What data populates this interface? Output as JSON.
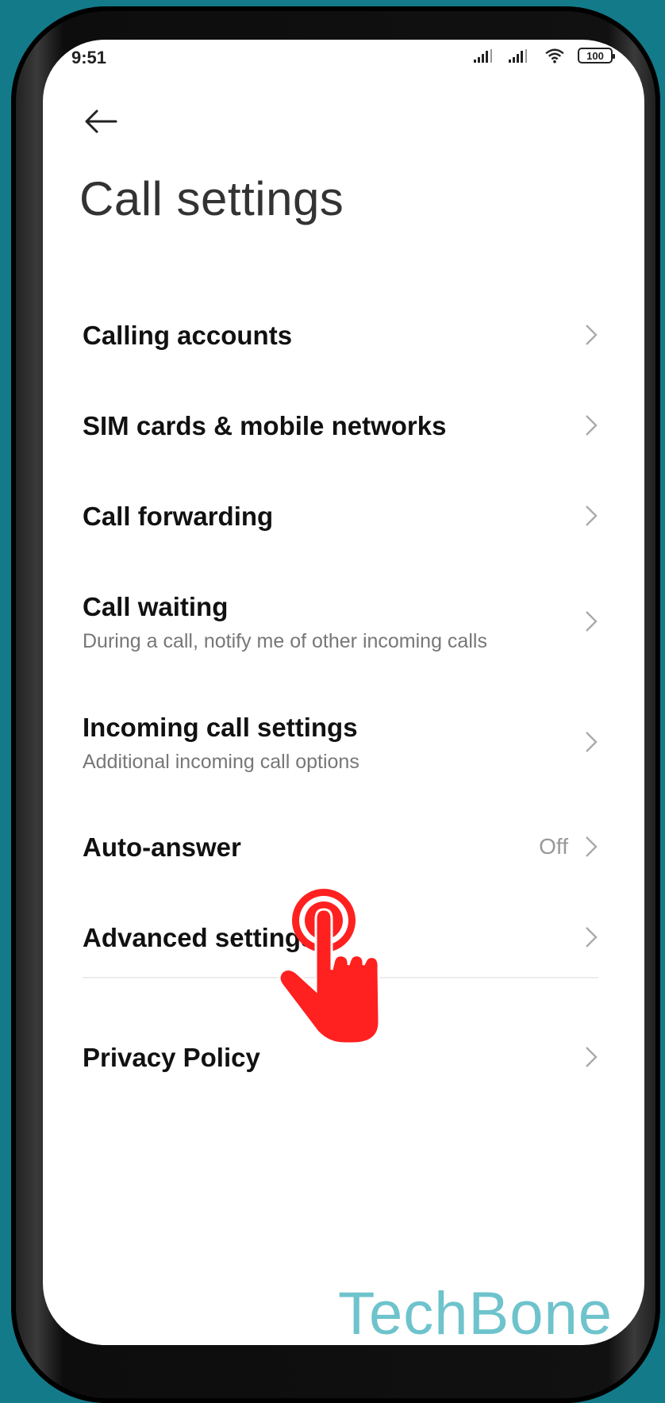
{
  "status_bar": {
    "time": "9:51",
    "battery": "100",
    "icons": [
      "signal-icon",
      "signal-icon",
      "wifi-icon",
      "battery-icon"
    ]
  },
  "header": {
    "back_icon": "back-arrow-icon",
    "title": "Call settings"
  },
  "items": [
    {
      "label": "Calling accounts"
    },
    {
      "label": "SIM cards & mobile networks"
    },
    {
      "label": "Call forwarding"
    },
    {
      "label": "Call waiting",
      "subtitle": "During a call, notify me of other incoming calls"
    },
    {
      "label": "Incoming call settings",
      "subtitle": "Additional incoming call options"
    },
    {
      "label": "Auto-answer",
      "value": "Off"
    },
    {
      "label": "Advanced settings"
    },
    {
      "label": "Privacy Policy"
    }
  ],
  "overlay": {
    "tap_indicator_icon": "tap-hand-icon",
    "color": "#ff2020"
  },
  "watermark": "TechBone",
  "colors": {
    "background": "#137a8a",
    "watermark": "#6ec3cc"
  }
}
